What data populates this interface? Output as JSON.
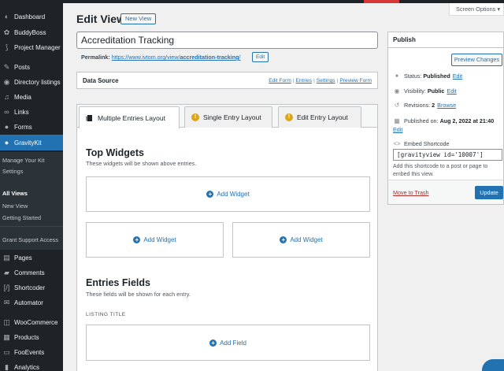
{
  "sidebar": {
    "items": [
      {
        "label": "Dashboard",
        "icon": "dashboard-icon",
        "glyph": "◐"
      },
      {
        "label": "BuddyBoss",
        "icon": "buddyboss-icon",
        "glyph": "✿"
      },
      {
        "label": "Project Manager",
        "icon": "project-manager-icon",
        "glyph": "⟆"
      },
      {
        "label": "Posts",
        "icon": "pin-icon",
        "glyph": "✎"
      },
      {
        "label": "Directory listings",
        "icon": "directory-icon",
        "glyph": "◉"
      },
      {
        "label": "Media",
        "icon": "media-icon",
        "glyph": "♫"
      },
      {
        "label": "Links",
        "icon": "link-icon",
        "glyph": "∞"
      },
      {
        "label": "Forms",
        "icon": "forms-icon",
        "glyph": "●"
      },
      {
        "label": "GravityKit",
        "icon": "gravitykit-icon",
        "glyph": "●"
      }
    ],
    "submenu": [
      "Manage Your Kit",
      "Settings",
      "All Views",
      "New View",
      "Getting Started",
      "Grant Support Access"
    ],
    "lower_items": [
      {
        "label": "Pages",
        "icon": "pages-icon",
        "glyph": "▤"
      },
      {
        "label": "Comments",
        "icon": "comments-icon",
        "glyph": "▰"
      },
      {
        "label": "Shortcoder",
        "icon": "shortcoder-icon",
        "glyph": "[/]"
      },
      {
        "label": "Automator",
        "icon": "automator-icon",
        "glyph": "✉"
      },
      {
        "label": "WooCommerce",
        "icon": "woocommerce-icon",
        "glyph": "◫"
      },
      {
        "label": "Products",
        "icon": "products-icon",
        "glyph": "▦"
      },
      {
        "label": "FooEvents",
        "icon": "fooevents-icon",
        "glyph": "▭"
      },
      {
        "label": "Analytics",
        "icon": "analytics-icon",
        "glyph": "▮"
      }
    ]
  },
  "header": {
    "title": "Edit View",
    "new_view": "New View",
    "screen_options": "Screen Options ▾"
  },
  "view": {
    "title": "Accreditation Tracking",
    "permalink_label": "Permalink:",
    "permalink_base": "https://www.ivtom.org/view/",
    "permalink_slug": "accreditation-tracking",
    "permalink_trail": "/",
    "edit_label": "Edit"
  },
  "data_source": {
    "title": "Data Source",
    "links": [
      "Edit Form",
      "Entries",
      "Settings",
      "Preview Form"
    ],
    "separator": "|"
  },
  "editor": {
    "tabs": [
      "Multiple Entries Layout",
      "Single Entry Layout",
      "Edit Entry Layout"
    ],
    "warn_glyph": "!",
    "top_widgets_title": "Top Widgets",
    "top_widgets_desc": "These widgets will be shown above entries.",
    "add_widget": "Add Widget",
    "entries_fields_title": "Entries Fields",
    "entries_fields_desc": "These fields will be shown for each entry.",
    "listing_title": "LISTING TITLE",
    "add_field": "Add Field",
    "plus_glyph": "+"
  },
  "publish": {
    "title": "Publish",
    "preview": "Preview Changes",
    "status_label": "Status:",
    "status_value": "Published",
    "visibility_label": "Visibility:",
    "visibility_value": "Public",
    "revisions_label": "Revisions:",
    "revisions_value": "2",
    "revisions_link": "Browse",
    "published_label": "Published on:",
    "published_value": "Aug 2, 2022 at 21:40",
    "edit": "Edit",
    "embed_label": "Embed Shortcode",
    "shortcode": "[gravityview id='10007']",
    "shortcode_help": "Add this shortcode to a post or page to embed this view.",
    "trash": "Move to Trash",
    "update": "Update"
  },
  "colors": {
    "accent": "#2271b1",
    "sidebar_bg": "#1d2327",
    "warning": "#dba617",
    "danger": "#b32d2e"
  }
}
